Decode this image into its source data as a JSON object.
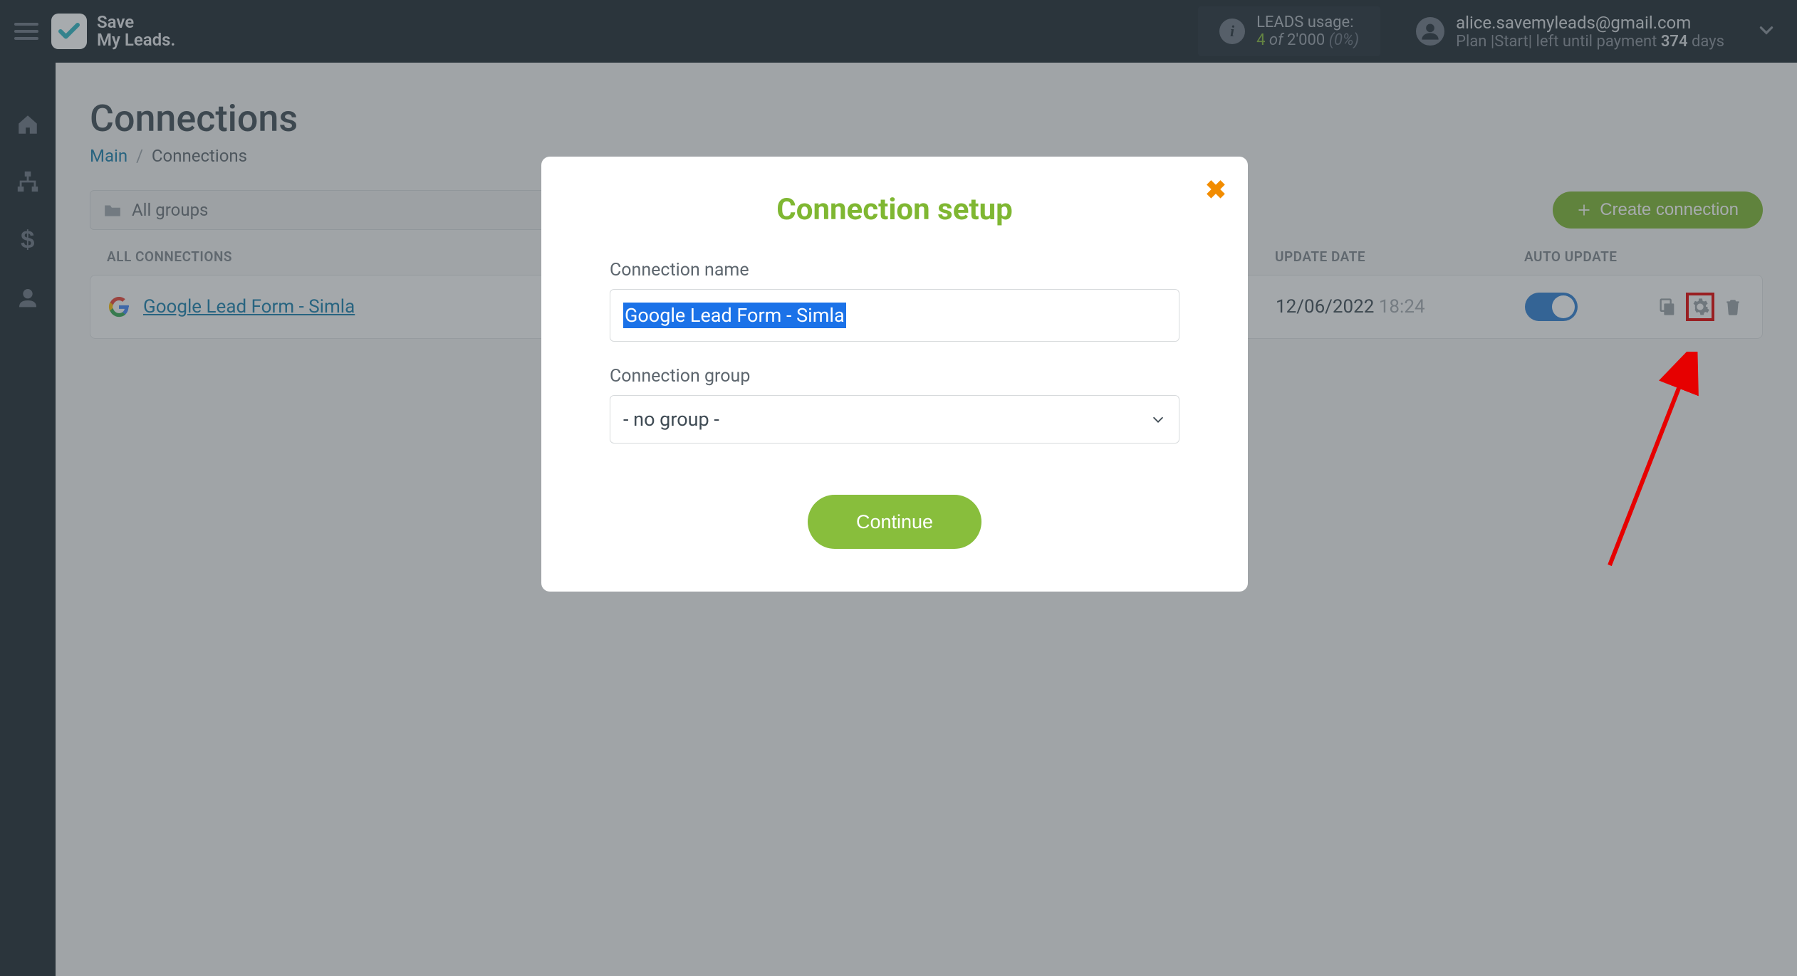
{
  "header": {
    "brand_line1": "Save",
    "brand_line2": "My Leads.",
    "leads_label": "LEADS usage:",
    "leads_num": "4",
    "leads_of": "of",
    "leads_total": "2'000",
    "leads_pct": "(0%)",
    "user_email": "alice.savemyleads@gmail.com",
    "plan_prefix": "Plan |Start| left until payment",
    "plan_days_num": "374",
    "plan_days_word": "days"
  },
  "page": {
    "title": "Connections",
    "breadcrumb_main": "Main",
    "breadcrumb_current": "Connections",
    "group_filter": "All groups",
    "create_btn": "Create connection",
    "col_name": "ALL CONNECTIONS",
    "col_date": "UPDATE DATE",
    "col_auto": "AUTO UPDATE"
  },
  "row": {
    "name": "Google Lead Form - Simla",
    "date": "12/06/2022",
    "time": "18:24"
  },
  "modal": {
    "title": "Connection setup",
    "name_label": "Connection name",
    "name_value": "Google Lead Form - Simla",
    "group_label": "Connection group",
    "group_value": "- no group -",
    "continue": "Continue"
  }
}
